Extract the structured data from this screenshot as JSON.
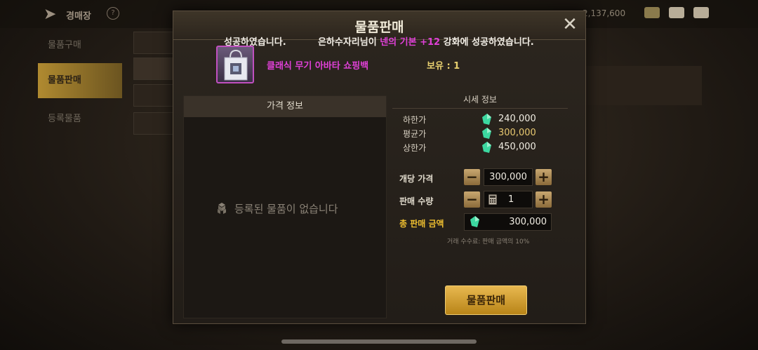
{
  "background": {
    "title": "경매장",
    "currency_text": "2,137,600",
    "sidebar": [
      {
        "label": "물품구매"
      },
      {
        "label": "물품판매"
      },
      {
        "label": "등록물품"
      }
    ]
  },
  "modal": {
    "title": "물품판매",
    "notice": {
      "prefix": "성공하였습니다.",
      "name_text": "은하수자리님이",
      "item_text": "넨의 기본 +12",
      "suffix": "강화에 성공하였습니다."
    },
    "item": {
      "name": "클래식 무기 아바타 쇼핑백",
      "owned": "보유 : 1",
      "rarity_color": "#e040d8"
    },
    "price_panel": {
      "header": "가격 정보",
      "empty_text": "등록된 물품이 없습니다"
    },
    "market": {
      "title": "시세 정보",
      "rows": [
        {
          "label": "하한가",
          "value": "240,000"
        },
        {
          "label": "평균가",
          "value": "300,000"
        },
        {
          "label": "상한가",
          "value": "450,000"
        }
      ]
    },
    "unit_price": {
      "label": "개당 가격",
      "value": "300,000"
    },
    "quantity": {
      "label": "판매 수량",
      "value": "1"
    },
    "total": {
      "label": "총 판매 금액",
      "value": "300,000"
    },
    "fee_text": "거래 수수료: 판매 금액의 10%",
    "sell_button": "물품판매",
    "minus_symbol": "−",
    "plus_symbol": "+",
    "close_symbol": "✕"
  },
  "colors": {
    "accent_gold": "#f0c030",
    "gem_green": "#3cd8a0"
  }
}
